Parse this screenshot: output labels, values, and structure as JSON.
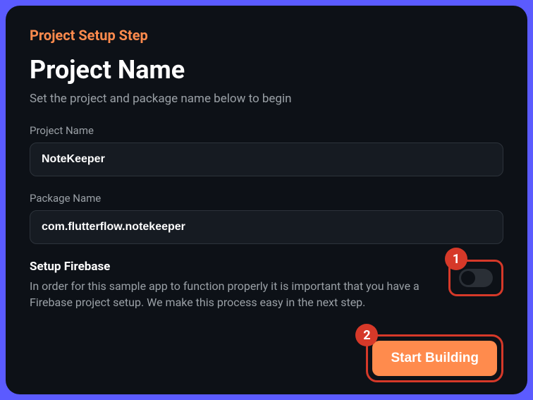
{
  "header": {
    "step_label": "Project Setup Step",
    "title": "Project Name",
    "subtitle": "Set the project and package name below to begin"
  },
  "fields": {
    "project_name": {
      "label": "Project Name",
      "value": "NoteKeeper"
    },
    "package_name": {
      "label": "Package Name",
      "value": "com.flutterflow.notekeeper"
    }
  },
  "firebase": {
    "title": "Setup Firebase",
    "description": "In order for this sample app to function properly it is important that you have a Firebase project setup. We make this process easy in the next step."
  },
  "annotations": {
    "badge_1": "1",
    "badge_2": "2"
  },
  "actions": {
    "start_label": "Start Building"
  }
}
